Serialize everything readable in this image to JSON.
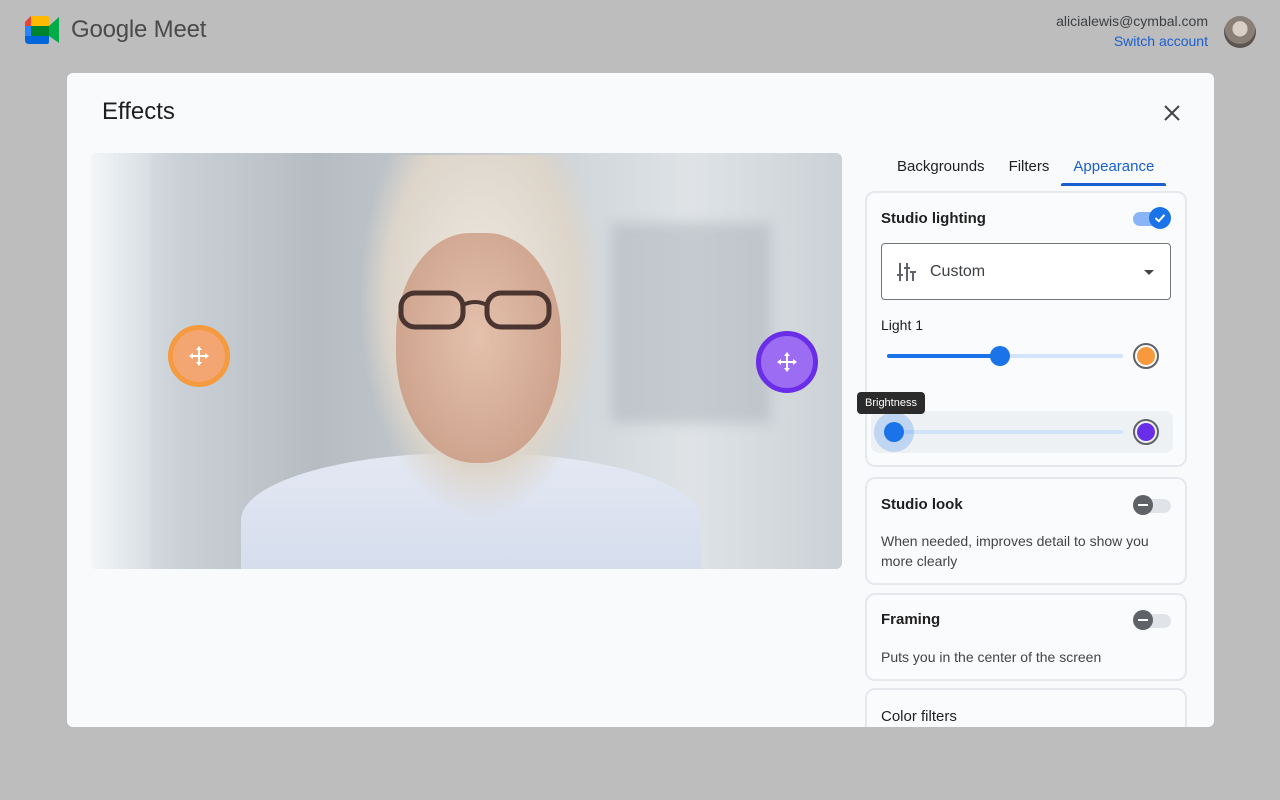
{
  "app": {
    "name": "Google Meet"
  },
  "account": {
    "email": "alicialewis@cymbal.com",
    "switch_label": "Switch account"
  },
  "dialog": {
    "title": "Effects",
    "tabs": [
      {
        "label": "Backgrounds",
        "active": false
      },
      {
        "label": "Filters",
        "active": false
      },
      {
        "label": "Appearance",
        "active": true
      }
    ],
    "studio_lighting": {
      "title": "Studio lighting",
      "enabled": true,
      "mode_select": "Custom",
      "light1": {
        "label": "Light 1",
        "brightness": 0.48,
        "color": "#f79a3e"
      },
      "light2": {
        "brightness": 0.03,
        "color": "#6a2ee8"
      },
      "tooltip": "Brightness"
    },
    "studio_look": {
      "title": "Studio look",
      "enabled": false,
      "description": "When needed, improves detail to show you more clearly"
    },
    "framing": {
      "title": "Framing",
      "enabled": false,
      "description": "Puts you in the center of the screen"
    },
    "color_filters": {
      "title": "Color filters"
    }
  },
  "colors": {
    "accent": "#1a73e8",
    "light_orange": "#f79a3e",
    "light_purple": "#6a2ee8"
  }
}
